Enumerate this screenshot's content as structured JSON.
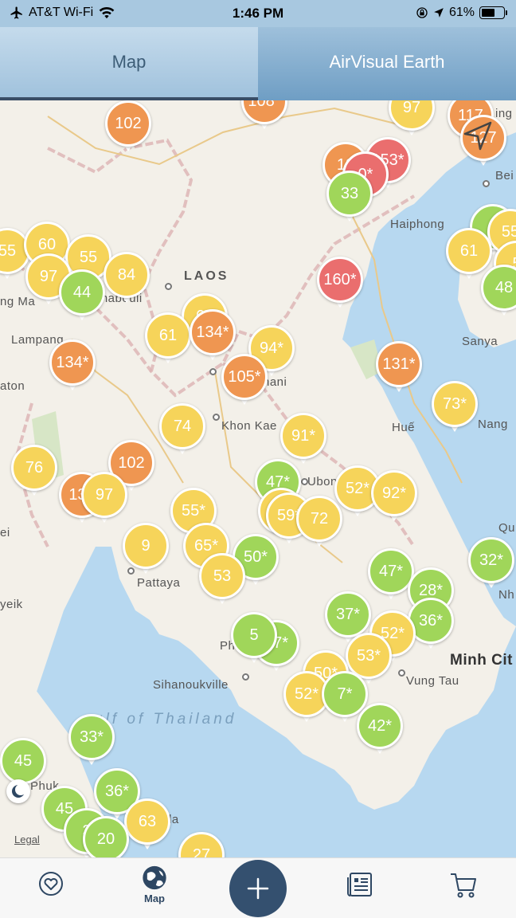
{
  "status_bar": {
    "carrier": "AT&T Wi-Fi",
    "time": "1:46 PM",
    "battery": "61%",
    "battery_level": 0.61
  },
  "tabs": [
    {
      "label": "Map",
      "active": true
    },
    {
      "label": "AirVisual Earth",
      "active": false
    }
  ],
  "map": {
    "places": [
      {
        "label": "LAOS",
        "kind": "country"
      },
      {
        "label": "Haiphong",
        "kind": "city"
      },
      {
        "label": "Lampang",
        "kind": "city"
      },
      {
        "label": "aton",
        "kind": "city"
      },
      {
        "label": "Sanya",
        "kind": "city"
      },
      {
        "label": "Khon Kae",
        "kind": "city"
      },
      {
        "label": "Huế",
        "kind": "city"
      },
      {
        "label": "Nang",
        "kind": "city"
      },
      {
        "label": "Ubon R",
        "kind": "city"
      },
      {
        "label": "Pattaya",
        "kind": "city"
      },
      {
        "label": "Sihanoukville",
        "kind": "city"
      },
      {
        "label": "Vung Tau",
        "kind": "city"
      },
      {
        "label": "Minh Cit",
        "kind": "city"
      },
      {
        "label": "ulf of Thailand",
        "kind": "sea"
      },
      {
        "label": "ng Ma",
        "kind": "city"
      },
      {
        "label": "gnabouli",
        "kind": "city"
      },
      {
        "label": "hani",
        "kind": "city"
      },
      {
        "label": "Bei",
        "kind": "city"
      },
      {
        "label": "Qu",
        "kind": "city"
      },
      {
        "label": "Nh",
        "kind": "city"
      },
      {
        "label": "yeik",
        "kind": "city"
      },
      {
        "label": "ei",
        "kind": "city"
      },
      {
        "label": "Ph",
        "kind": "city"
      },
      {
        "label": "Phuk",
        "kind": "city"
      },
      {
        "label": "la",
        "kind": "city"
      },
      {
        "label": "ing",
        "kind": "city"
      }
    ],
    "markers": [
      {
        "value": "102",
        "color": "orange"
      },
      {
        "value": "108*",
        "color": "orange"
      },
      {
        "value": "97",
        "color": "yellow"
      },
      {
        "value": "117",
        "color": "orange"
      },
      {
        "value": "127",
        "color": "orange"
      },
      {
        "value": "153*",
        "color": "red"
      },
      {
        "value": "13",
        "color": "orange"
      },
      {
        "value": "0*",
        "color": "red"
      },
      {
        "value": "33",
        "color": "green"
      },
      {
        "value": "4",
        "color": "green"
      },
      {
        "value": "55",
        "color": "yellow"
      },
      {
        "value": "61",
        "color": "yellow"
      },
      {
        "value": "5",
        "color": "yellow"
      },
      {
        "value": "48",
        "color": "green"
      },
      {
        "value": "55",
        "color": "yellow"
      },
      {
        "value": "60",
        "color": "yellow"
      },
      {
        "value": "55",
        "color": "yellow"
      },
      {
        "value": "97",
        "color": "yellow"
      },
      {
        "value": "84",
        "color": "yellow"
      },
      {
        "value": "44",
        "color": "green"
      },
      {
        "value": "160*",
        "color": "red"
      },
      {
        "value": "67",
        "color": "yellow"
      },
      {
        "value": "61",
        "color": "yellow"
      },
      {
        "value": "134*",
        "color": "orange"
      },
      {
        "value": "94*",
        "color": "yellow"
      },
      {
        "value": "134*",
        "color": "orange"
      },
      {
        "value": "105*",
        "color": "orange"
      },
      {
        "value": "131*",
        "color": "orange"
      },
      {
        "value": "73*",
        "color": "yellow"
      },
      {
        "value": "74",
        "color": "yellow"
      },
      {
        "value": "91*",
        "color": "yellow"
      },
      {
        "value": "102",
        "color": "orange"
      },
      {
        "value": "76",
        "color": "yellow"
      },
      {
        "value": "134",
        "color": "orange"
      },
      {
        "value": "97",
        "color": "yellow"
      },
      {
        "value": "47*",
        "color": "green"
      },
      {
        "value": "52*",
        "color": "yellow"
      },
      {
        "value": "92*",
        "color": "yellow"
      },
      {
        "value": "55*",
        "color": "yellow"
      },
      {
        "value": "69*",
        "color": "yellow"
      },
      {
        "value": "59*",
        "color": "yellow"
      },
      {
        "value": "72",
        "color": "yellow"
      },
      {
        "value": "9",
        "color": "yellow"
      },
      {
        "value": "65*",
        "color": "yellow"
      },
      {
        "value": "50*",
        "color": "green"
      },
      {
        "value": "47*",
        "color": "green"
      },
      {
        "value": "32*",
        "color": "green"
      },
      {
        "value": "28*",
        "color": "green"
      },
      {
        "value": "53",
        "color": "yellow"
      },
      {
        "value": "37*",
        "color": "green"
      },
      {
        "value": "36*",
        "color": "green"
      },
      {
        "value": "52*",
        "color": "yellow"
      },
      {
        "value": "47*",
        "color": "green"
      },
      {
        "value": "5",
        "color": "green"
      },
      {
        "value": "53*",
        "color": "yellow"
      },
      {
        "value": "50*",
        "color": "yellow"
      },
      {
        "value": "52*",
        "color": "yellow"
      },
      {
        "value": "7*",
        "color": "green"
      },
      {
        "value": "42*",
        "color": "green"
      },
      {
        "value": "33*",
        "color": "green"
      },
      {
        "value": "45",
        "color": "green"
      },
      {
        "value": "36*",
        "color": "green"
      },
      {
        "value": "45",
        "color": "green"
      },
      {
        "value": "63",
        "color": "yellow"
      },
      {
        "value": "3",
        "color": "green"
      },
      {
        "value": "20",
        "color": "green"
      },
      {
        "value": "27",
        "color": "yellow"
      }
    ],
    "legal": "Legal"
  },
  "bottom_nav": {
    "favorites_icon": "heart-icon",
    "map_label": "Map",
    "add_icon": "plus-icon",
    "news_icon": "news-icon",
    "shop_icon": "cart-icon"
  },
  "colors": {
    "header": "#87b2d3",
    "nav_accent": "#34506f",
    "good": "#a0d65a",
    "moderate": "#f6d45a",
    "sensitive": "#ef9651",
    "unhealthy": "#ea6e6e",
    "very_unhealthy": "#9e73bd",
    "water": "#b7d8f0"
  }
}
